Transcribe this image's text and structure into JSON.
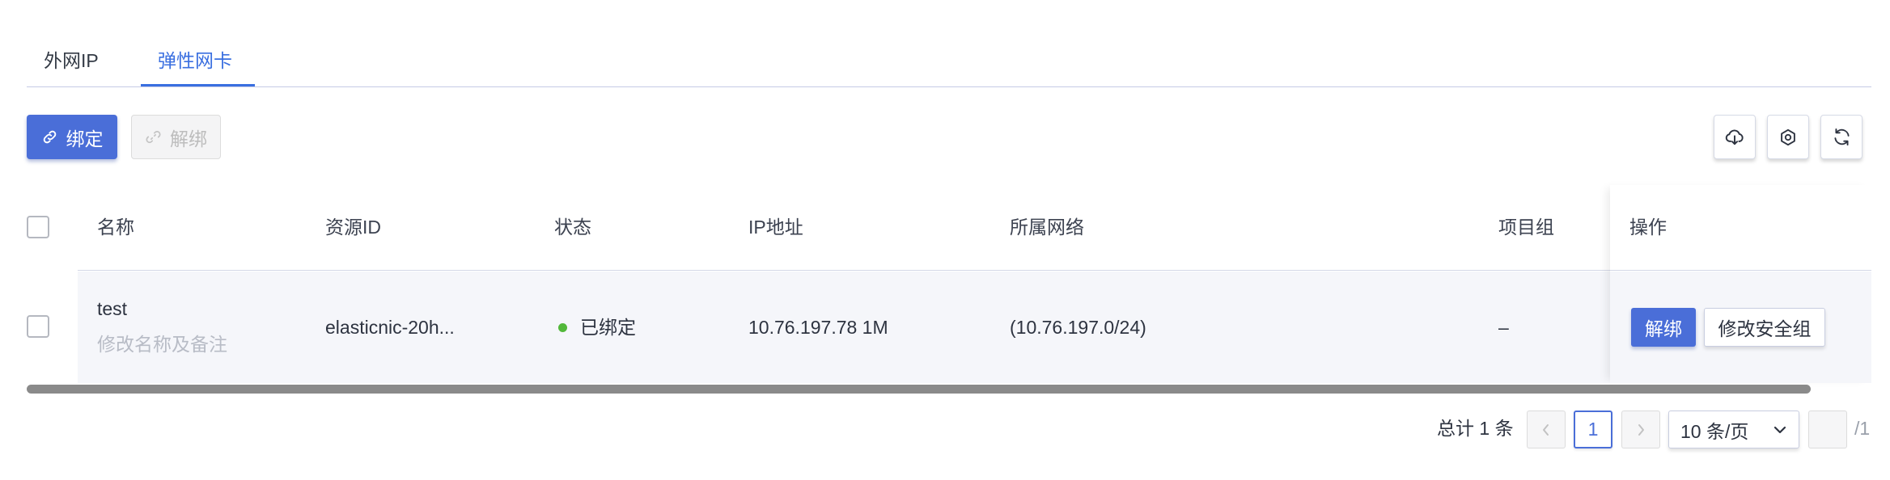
{
  "tabs": [
    {
      "label": "外网IP",
      "active": false
    },
    {
      "label": "弹性网卡",
      "active": true
    }
  ],
  "toolbar": {
    "bind_label": "绑定",
    "unbind_label": "解绑",
    "unbind_disabled": true
  },
  "table": {
    "columns": [
      "名称",
      "资源ID",
      "状态",
      "IP地址",
      "所属网络",
      "项目组",
      "操作"
    ],
    "rows": [
      {
        "name": "test",
        "note": "修改名称及备注",
        "resource_id": "elasticnic-20h...",
        "status": "已绑定",
        "ip": "10.76.197.78 1M",
        "network": "(10.76.197.0/24)",
        "project_group": "–",
        "actions": [
          "解绑",
          "修改安全组"
        ]
      }
    ]
  },
  "pagination": {
    "total_text": "总计 1 条",
    "current_page": "1",
    "page_size": "10 条/页",
    "total_pages": "/1"
  },
  "icons": {
    "bind": "link-icon",
    "unbind": "unlink-icon",
    "download": "cloud-download-icon",
    "settings": "gear-icon",
    "refresh": "refresh-icon"
  },
  "colors": {
    "accent": "#4a6ed8",
    "active_tab": "#3a6fe0",
    "status_bound": "#52b83a",
    "row_background": "#f5f6fa"
  }
}
